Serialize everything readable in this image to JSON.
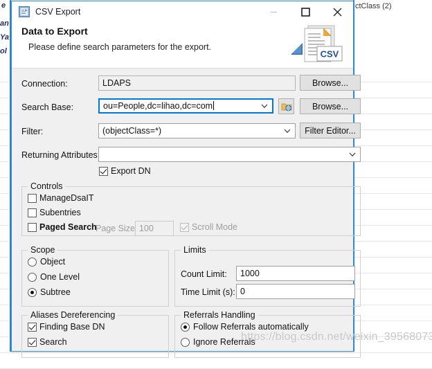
{
  "background": {
    "top_right_text": "ctClass (2)",
    "left_fragments": [
      "e",
      "an",
      "Ya",
      "ol"
    ]
  },
  "window": {
    "title": "CSV Export",
    "icon": "csv-export-app-icon",
    "controls": {
      "minimize": "minimize-icon",
      "maximize": "maximize-icon",
      "close": "close-icon"
    }
  },
  "header": {
    "title": "Data to Export",
    "subtitle": "Please define search parameters for the export.",
    "logo_label": "CSV"
  },
  "form": {
    "connection": {
      "label": "Connection:",
      "value": "LDAPS",
      "browse_label": "Browse..."
    },
    "search_base": {
      "label": "Search Base:",
      "value": "ou=People,dc=lihao,dc=com",
      "picker_icon": "browse-dn-icon",
      "browse_label": "Browse..."
    },
    "filter": {
      "label": "Filter:",
      "value": "(objectClass=*)",
      "editor_label": "Filter Editor..."
    },
    "returning_attributes": {
      "label": "Returning Attributes:",
      "value": "",
      "placeholder": ""
    },
    "export_dn": {
      "label": "Export DN",
      "checked": true
    }
  },
  "controls_group": {
    "title": "Controls",
    "items": [
      {
        "label": "ManageDsaIT",
        "checked": false,
        "disabled": false
      },
      {
        "label": "Subentries",
        "checked": false,
        "disabled": false
      },
      {
        "label": "Paged Search",
        "checked": false,
        "disabled": false
      }
    ],
    "page_size": {
      "label": "Page Size:",
      "value": "100",
      "disabled": true
    },
    "scroll_mode": {
      "label": "Scroll Mode",
      "checked": true,
      "disabled": true
    }
  },
  "scope_group": {
    "title": "Scope",
    "options": [
      {
        "label": "Object",
        "selected": false
      },
      {
        "label": "One Level",
        "selected": false
      },
      {
        "label": "Subtree",
        "selected": true
      }
    ]
  },
  "limits_group": {
    "title": "Limits",
    "count_limit": {
      "label": "Count Limit:",
      "value": "1000"
    },
    "time_limit": {
      "label": "Time Limit (s):",
      "value": "0"
    }
  },
  "aliases_group": {
    "title": "Aliases Dereferencing",
    "items": [
      {
        "label": "Finding Base DN",
        "checked": true
      },
      {
        "label": "Search",
        "checked": true
      }
    ]
  },
  "referrals_group": {
    "title": "Referrals Handling",
    "options": [
      {
        "label": "Follow Referrals automatically",
        "selected": true
      },
      {
        "label": "Ignore Referrals",
        "selected": false
      }
    ]
  },
  "watermark": "https://blog.csdn.net/weixin_39568073",
  "colors": {
    "dialog_border": "#3b8fd6",
    "dialog_bg": "#f0f0f0",
    "focus_border": "#0078d7",
    "accent_blue": "#2f8fe0",
    "csv_orange": "#e8a33d"
  }
}
